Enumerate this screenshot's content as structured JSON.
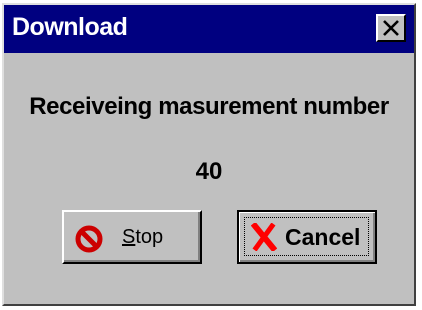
{
  "window": {
    "title": "Download",
    "close_glyph": "X"
  },
  "main": {
    "message": "Receiveing masurement number",
    "count": "40"
  },
  "buttons": {
    "stop": {
      "mnemonic": "S",
      "rest": "top",
      "icon": "stop-icon"
    },
    "cancel": {
      "label": "Cancel",
      "icon": "cancel-x-icon"
    }
  },
  "colors": {
    "titlebar": "#000080",
    "face": "#c0c0c0",
    "stop_icon": "#cc0000",
    "cancel_icon": "#ff0000"
  }
}
